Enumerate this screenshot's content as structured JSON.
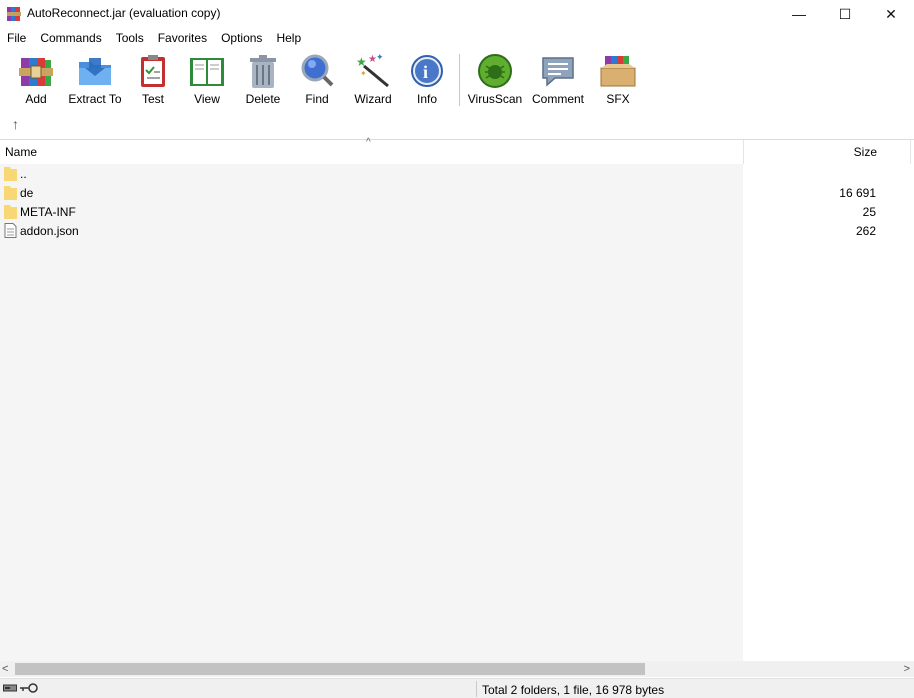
{
  "window": {
    "title": "AutoReconnect.jar (evaluation copy)",
    "controls": {
      "minimize": "—",
      "maximize": "☐",
      "close": "✕"
    }
  },
  "menu": [
    "File",
    "Commands",
    "Tools",
    "Favorites",
    "Options",
    "Help"
  ],
  "toolbar": {
    "buttons": [
      {
        "label": "Add",
        "icon": "add-archive-icon"
      },
      {
        "label": "Extract To",
        "icon": "extract-folder-icon"
      },
      {
        "label": "Test",
        "icon": "test-clipboard-icon"
      },
      {
        "label": "View",
        "icon": "view-book-icon"
      },
      {
        "label": "Delete",
        "icon": "trash-can-icon"
      },
      {
        "label": "Find",
        "icon": "magnifier-icon"
      },
      {
        "label": "Wizard",
        "icon": "magic-wand-icon"
      },
      {
        "label": "Info",
        "icon": "info-icon"
      },
      {
        "label": "VirusScan",
        "icon": "bug-scan-icon"
      },
      {
        "label": "Comment",
        "icon": "comment-bubble-icon"
      },
      {
        "label": "SFX",
        "icon": "sfx-box-icon"
      }
    ],
    "up_arrow": "↑"
  },
  "list": {
    "columns": {
      "name": "Name",
      "size": "Size"
    },
    "sort_indicator": "^",
    "rows": [
      {
        "name": "..",
        "size": "",
        "type": "folder"
      },
      {
        "name": "de",
        "size": "16 691",
        "type": "folder"
      },
      {
        "name": "META-INF",
        "size": "25",
        "type": "folder"
      },
      {
        "name": "addon.json",
        "size": "262",
        "type": "file"
      }
    ]
  },
  "scrollbar": {
    "left_arrow": "<",
    "right_arrow": ">"
  },
  "status": {
    "text": "Total 2 folders, 1 file, 16 978 bytes"
  },
  "colors": {
    "folder": "#f8d775",
    "list_background": "#f5f5f5",
    "statusbar": "#f0f0f0"
  }
}
